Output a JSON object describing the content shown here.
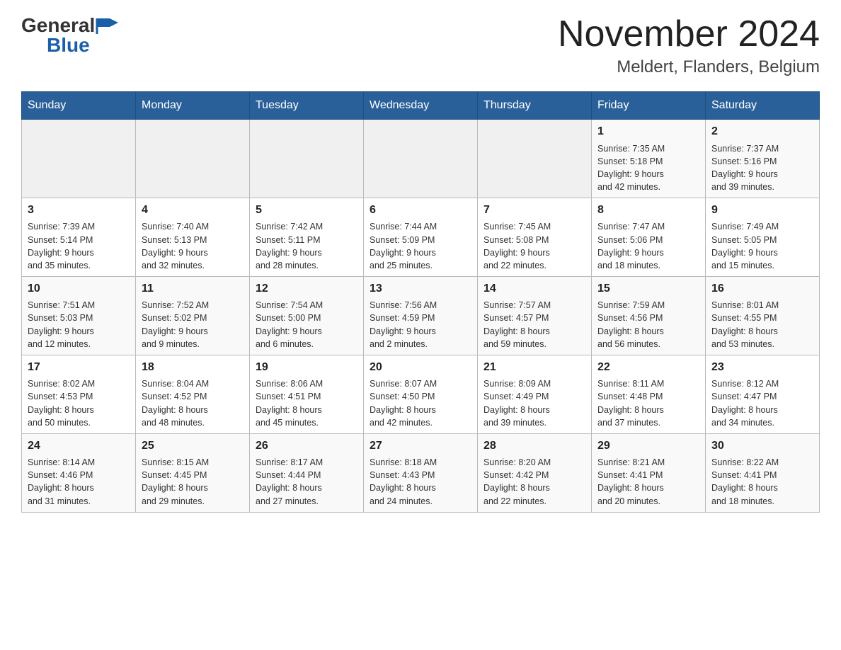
{
  "header": {
    "logo_general": "General",
    "logo_blue": "Blue",
    "title": "November 2024",
    "location": "Meldert, Flanders, Belgium"
  },
  "days_of_week": [
    "Sunday",
    "Monday",
    "Tuesday",
    "Wednesday",
    "Thursday",
    "Friday",
    "Saturday"
  ],
  "weeks": [
    [
      {
        "day": "",
        "info": ""
      },
      {
        "day": "",
        "info": ""
      },
      {
        "day": "",
        "info": ""
      },
      {
        "day": "",
        "info": ""
      },
      {
        "day": "",
        "info": ""
      },
      {
        "day": "1",
        "info": "Sunrise: 7:35 AM\nSunset: 5:18 PM\nDaylight: 9 hours\nand 42 minutes."
      },
      {
        "day": "2",
        "info": "Sunrise: 7:37 AM\nSunset: 5:16 PM\nDaylight: 9 hours\nand 39 minutes."
      }
    ],
    [
      {
        "day": "3",
        "info": "Sunrise: 7:39 AM\nSunset: 5:14 PM\nDaylight: 9 hours\nand 35 minutes."
      },
      {
        "day": "4",
        "info": "Sunrise: 7:40 AM\nSunset: 5:13 PM\nDaylight: 9 hours\nand 32 minutes."
      },
      {
        "day": "5",
        "info": "Sunrise: 7:42 AM\nSunset: 5:11 PM\nDaylight: 9 hours\nand 28 minutes."
      },
      {
        "day": "6",
        "info": "Sunrise: 7:44 AM\nSunset: 5:09 PM\nDaylight: 9 hours\nand 25 minutes."
      },
      {
        "day": "7",
        "info": "Sunrise: 7:45 AM\nSunset: 5:08 PM\nDaylight: 9 hours\nand 22 minutes."
      },
      {
        "day": "8",
        "info": "Sunrise: 7:47 AM\nSunset: 5:06 PM\nDaylight: 9 hours\nand 18 minutes."
      },
      {
        "day": "9",
        "info": "Sunrise: 7:49 AM\nSunset: 5:05 PM\nDaylight: 9 hours\nand 15 minutes."
      }
    ],
    [
      {
        "day": "10",
        "info": "Sunrise: 7:51 AM\nSunset: 5:03 PM\nDaylight: 9 hours\nand 12 minutes."
      },
      {
        "day": "11",
        "info": "Sunrise: 7:52 AM\nSunset: 5:02 PM\nDaylight: 9 hours\nand 9 minutes."
      },
      {
        "day": "12",
        "info": "Sunrise: 7:54 AM\nSunset: 5:00 PM\nDaylight: 9 hours\nand 6 minutes."
      },
      {
        "day": "13",
        "info": "Sunrise: 7:56 AM\nSunset: 4:59 PM\nDaylight: 9 hours\nand 2 minutes."
      },
      {
        "day": "14",
        "info": "Sunrise: 7:57 AM\nSunset: 4:57 PM\nDaylight: 8 hours\nand 59 minutes."
      },
      {
        "day": "15",
        "info": "Sunrise: 7:59 AM\nSunset: 4:56 PM\nDaylight: 8 hours\nand 56 minutes."
      },
      {
        "day": "16",
        "info": "Sunrise: 8:01 AM\nSunset: 4:55 PM\nDaylight: 8 hours\nand 53 minutes."
      }
    ],
    [
      {
        "day": "17",
        "info": "Sunrise: 8:02 AM\nSunset: 4:53 PM\nDaylight: 8 hours\nand 50 minutes."
      },
      {
        "day": "18",
        "info": "Sunrise: 8:04 AM\nSunset: 4:52 PM\nDaylight: 8 hours\nand 48 minutes."
      },
      {
        "day": "19",
        "info": "Sunrise: 8:06 AM\nSunset: 4:51 PM\nDaylight: 8 hours\nand 45 minutes."
      },
      {
        "day": "20",
        "info": "Sunrise: 8:07 AM\nSunset: 4:50 PM\nDaylight: 8 hours\nand 42 minutes."
      },
      {
        "day": "21",
        "info": "Sunrise: 8:09 AM\nSunset: 4:49 PM\nDaylight: 8 hours\nand 39 minutes."
      },
      {
        "day": "22",
        "info": "Sunrise: 8:11 AM\nSunset: 4:48 PM\nDaylight: 8 hours\nand 37 minutes."
      },
      {
        "day": "23",
        "info": "Sunrise: 8:12 AM\nSunset: 4:47 PM\nDaylight: 8 hours\nand 34 minutes."
      }
    ],
    [
      {
        "day": "24",
        "info": "Sunrise: 8:14 AM\nSunset: 4:46 PM\nDaylight: 8 hours\nand 31 minutes."
      },
      {
        "day": "25",
        "info": "Sunrise: 8:15 AM\nSunset: 4:45 PM\nDaylight: 8 hours\nand 29 minutes."
      },
      {
        "day": "26",
        "info": "Sunrise: 8:17 AM\nSunset: 4:44 PM\nDaylight: 8 hours\nand 27 minutes."
      },
      {
        "day": "27",
        "info": "Sunrise: 8:18 AM\nSunset: 4:43 PM\nDaylight: 8 hours\nand 24 minutes."
      },
      {
        "day": "28",
        "info": "Sunrise: 8:20 AM\nSunset: 4:42 PM\nDaylight: 8 hours\nand 22 minutes."
      },
      {
        "day": "29",
        "info": "Sunrise: 8:21 AM\nSunset: 4:41 PM\nDaylight: 8 hours\nand 20 minutes."
      },
      {
        "day": "30",
        "info": "Sunrise: 8:22 AM\nSunset: 4:41 PM\nDaylight: 8 hours\nand 18 minutes."
      }
    ]
  ]
}
